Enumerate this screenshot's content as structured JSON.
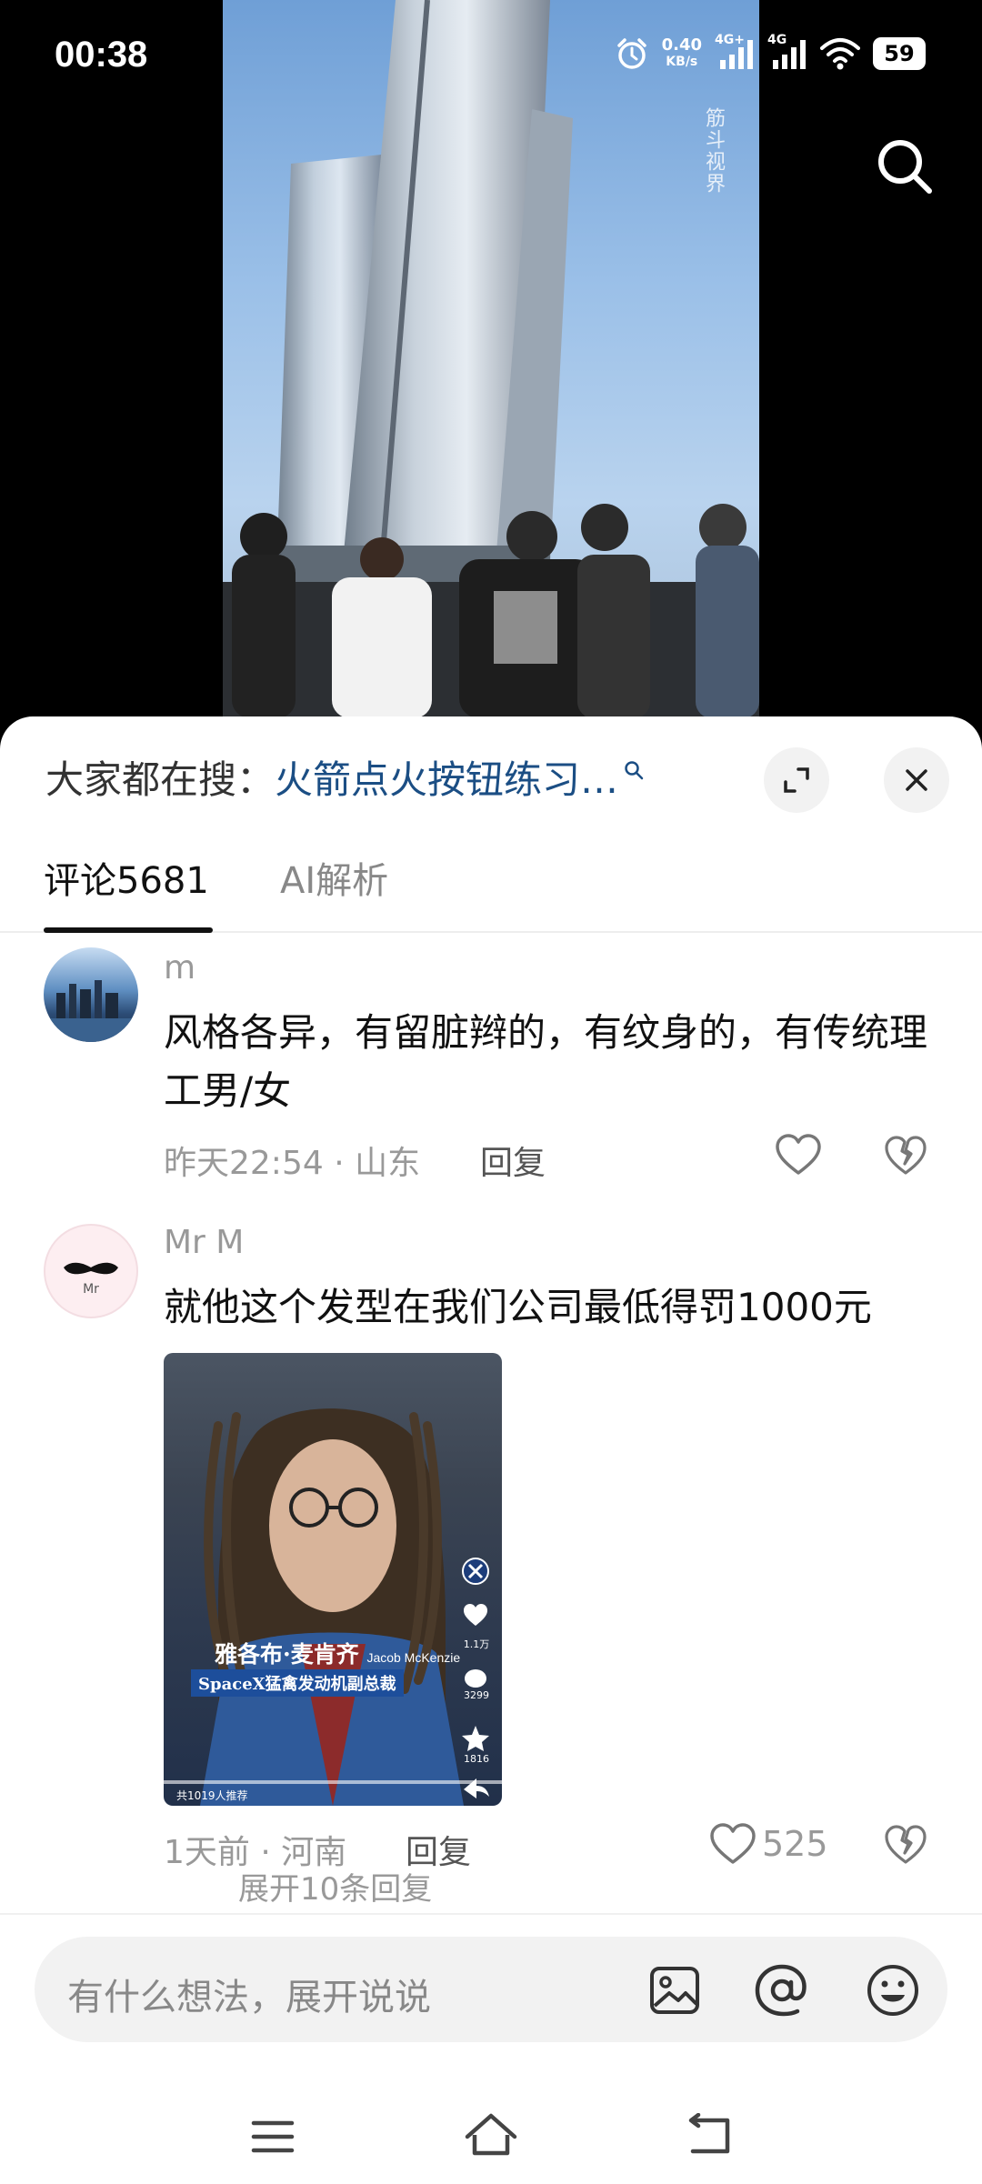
{
  "status_bar": {
    "time": "00:38",
    "net_speed_value": "0.40",
    "net_speed_unit": "KB/s",
    "signal1_label": "4G+",
    "signal2_label": "4G",
    "battery": "59"
  },
  "video": {
    "watermark": "筋斗视界"
  },
  "panel": {
    "trend_prefix": "大家都在搜：",
    "trend_query": "火箭点火按钮练习…",
    "tabs": [
      {
        "label": "评论5681"
      },
      {
        "label": "AI解析"
      }
    ],
    "comments": [
      {
        "username": "m",
        "text": "风格各异，有留脏辫的，有纹身的，有传统理工男/女",
        "time": "昨天22:54",
        "location": "山东",
        "reply": "回复"
      },
      {
        "username": "Mr M",
        "avatar_text": "Mr",
        "text": "就他这个发型在我们公司最低得罚1000元",
        "time": "1天前",
        "location": "河南",
        "reply": "回复",
        "likes": "525",
        "image": {
          "name_cn": "雅各布·麦肯齐",
          "name_en": "Jacob McKenzie",
          "title": "SpaceX猛禽发动机副总裁",
          "like_count": "1.1万",
          "comment_count": "3299",
          "fav_count": "1816",
          "recommend": "共1019人推荐"
        }
      }
    ],
    "expand_more": "展开10条回复"
  },
  "bottom": {
    "input_placeholder": "有什么想法，展开说说"
  }
}
